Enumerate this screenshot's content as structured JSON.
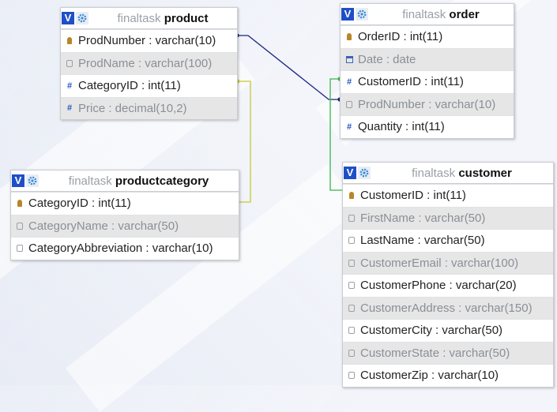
{
  "tables": {
    "product": {
      "schema": "finaltask",
      "name": "product",
      "columns": [
        {
          "text": "ProdNumber : varchar(10)",
          "icon": "primary-key-icon"
        },
        {
          "text": "ProdName : varchar(100)",
          "icon": "field-icon"
        },
        {
          "text": "CategoryID : int(11)",
          "icon": "hash-icon"
        },
        {
          "text": "Price : decimal(10,2)",
          "icon": "hash-icon"
        }
      ]
    },
    "order": {
      "schema": "finaltask",
      "name": "order",
      "columns": [
        {
          "text": "OrderID : int(11)",
          "icon": "primary-key-icon"
        },
        {
          "text": "Date : date",
          "icon": "calendar-icon"
        },
        {
          "text": "CustomerID : int(11)",
          "icon": "hash-icon"
        },
        {
          "text": "ProdNumber : varchar(10)",
          "icon": "field-icon"
        },
        {
          "text": "Quantity : int(11)",
          "icon": "hash-icon"
        }
      ]
    },
    "productcategory": {
      "schema": "finaltask",
      "name": "productcategory",
      "columns": [
        {
          "text": "CategoryID : int(11)",
          "icon": "primary-key-icon"
        },
        {
          "text": "CategoryName : varchar(50)",
          "icon": "field-icon"
        },
        {
          "text": "CategoryAbbreviation : varchar(10)",
          "icon": "field-icon"
        }
      ]
    },
    "customer": {
      "schema": "finaltask",
      "name": "customer",
      "columns": [
        {
          "text": "CustomerID : int(11)",
          "icon": "primary-key-icon"
        },
        {
          "text": "FirstName : varchar(50)",
          "icon": "field-icon"
        },
        {
          "text": "LastName : varchar(50)",
          "icon": "field-icon"
        },
        {
          "text": "CustomerEmail : varchar(100)",
          "icon": "field-icon"
        },
        {
          "text": "CustomerPhone : varchar(20)",
          "icon": "field-icon"
        },
        {
          "text": "CustomerAddress : varchar(150)",
          "icon": "field-icon"
        },
        {
          "text": "CustomerCity : varchar(50)",
          "icon": "field-icon"
        },
        {
          "text": "CustomerState : varchar(50)",
          "icon": "field-icon"
        },
        {
          "text": "CustomerZip : varchar(10)",
          "icon": "field-icon"
        }
      ]
    }
  },
  "toolbar": {
    "v_label": "V"
  },
  "colors": {
    "link_product_order": "#1a237e",
    "link_category": "#c8c832",
    "link_customer": "#3cb44b",
    "header_button": "#1f4fc8"
  }
}
